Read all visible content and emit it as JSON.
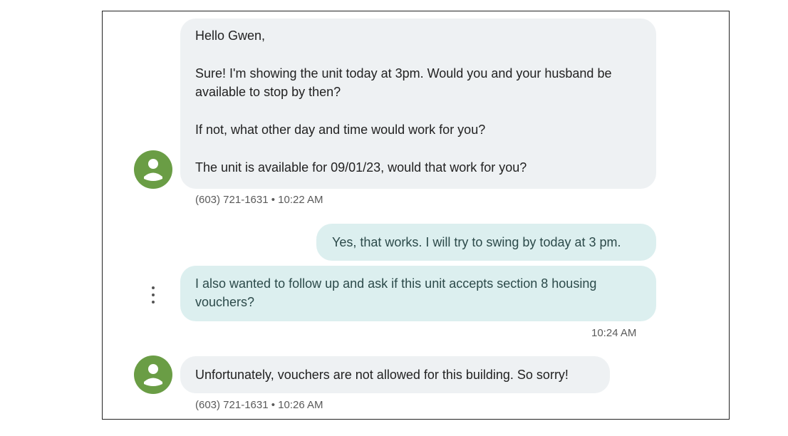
{
  "conversation": {
    "messages": [
      {
        "direction": "incoming",
        "paragraphs": [
          [
            "Hello Gwen,"
          ],
          [
            "Sure! I'm showing the unit today at 3pm. Would you and your husband be",
            "available to stop by then?"
          ],
          [
            "If not, what other day and time would work for you?"
          ],
          [
            "The unit is available for 09/01/23, would that work for you?"
          ]
        ],
        "meta": "(603) 721-1631 • 10:22 AM"
      },
      {
        "direction": "outgoing",
        "paragraphs": [
          [
            "Yes, that works. I will try to swing by today at 3 pm."
          ]
        ]
      },
      {
        "direction": "outgoing",
        "paragraphs": [
          [
            "I also wanted to follow up and ask if this unit accepts section 8 housing",
            "vouchers?"
          ]
        ],
        "meta": "10:24 AM"
      },
      {
        "direction": "incoming",
        "paragraphs": [
          [
            "Unfortunately, vouchers are not allowed for this building. So sorry!"
          ]
        ],
        "meta": "(603) 721-1631 • 10:26 AM"
      }
    ]
  },
  "icons": {
    "avatar": "person-icon",
    "more": "more-vert-icon"
  },
  "colors": {
    "avatar_bg": "#6a9d45",
    "incoming_bubble": "#eef1f3",
    "outgoing_bubble": "#dcefef",
    "outgoing_text": "#2c4a4a"
  }
}
